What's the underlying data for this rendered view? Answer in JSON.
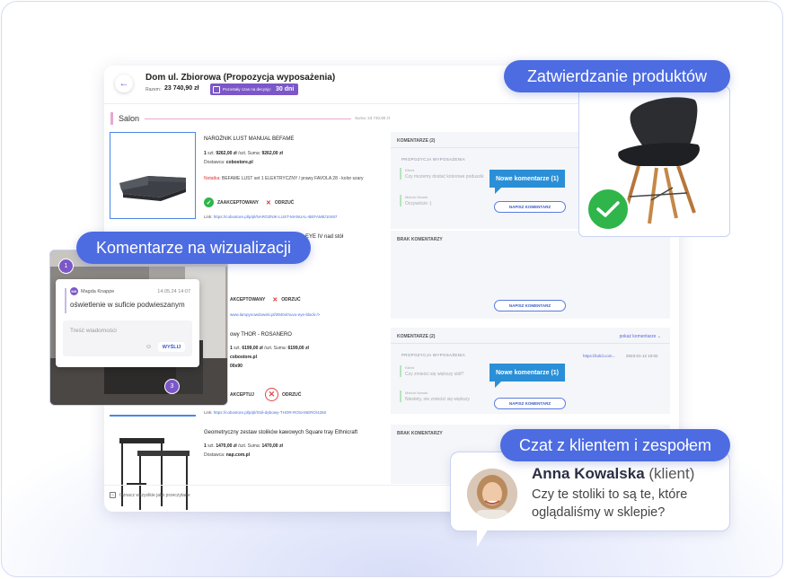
{
  "app": {
    "title": "Dom ul. Zbiorowa (Propozycja wyposażenia)",
    "sum_label": "Razem:",
    "sum_value": "23 740,90 zł",
    "deadline_text": "Pozostały czas na decyzję:",
    "deadline_days": "30 dni",
    "section_name": "Salon",
    "section_sum": "Suma: 23 740,90 zł",
    "mark_all_label": "Oznacz wszystkie jako przeczytane"
  },
  "products": [
    {
      "name": "NAROŻNIK LUST MANUAL BEFAME",
      "qty": "1",
      "unit": "szt.",
      "price": "9262,00 zł",
      "per": "/szt.",
      "sum_label": "Suma:",
      "sum": "9262,00 zł",
      "supplier_label": "Dostawca:",
      "supplier": "cobostore.pl",
      "note_label": "Notatka:",
      "note": "BEFAME LUST set 1 ELEKTRYCZNY / prawy FAVOLA 28 - kolor szary",
      "accepted": "ZAAKCEPTOWANY",
      "rejected": "ODRZUĆ",
      "link_label": "Link:",
      "link": "https://cobostore.pl/p/pl/NAROZNIK-LUST-MANUAL-BEFAME/10497"
    },
    {
      "name_partial": "EYE IV nad stół",
      "accepted": "AKCEPTOWANY",
      "rejected": "ODRZUĆ",
      "link": "www.lampynowdowski.pl/39404/nuvo-eye-black-/>"
    },
    {
      "name_partial": "owy THOR - ROSANERO",
      "qty": "1",
      "unit": "szt.",
      "price": "6199,00 zł",
      "per": "/szt.",
      "sum_label": "Suma:",
      "sum": "6199,00 zł",
      "supplier": "cobostore.pl",
      "size": "00x90",
      "accepted": "AKCEPTUJ",
      "rejected": "ODRZUĆ",
      "link": "https://cobostore.pl/p/pl/Stół-dębowy-THOR-ROSANERO/4260"
    },
    {
      "name": "Geometryczny zestaw stolików kawowych Square tray Ethnicraft",
      "qty": "1",
      "unit": "szt.",
      "price": "1470,00 zł",
      "per": "/szt.",
      "sum_label": "Suma:",
      "sum": "1470,00 zł",
      "supplier_label": "Dostawca:",
      "supplier": "nap.com.pl"
    }
  ],
  "comments": [
    {
      "header": "KOMENTARZE (2)",
      "tag": "PROPOZYCJA WYPOSAŻENIA",
      "quote_label": "Klient",
      "quote": "Czy możemy dostać kolorowe poduszki",
      "reply_label": "Marcin Nowak",
      "reply": "Oczywiście :)",
      "new_badge": "Nowe komentarze (1)",
      "write": "NAPISZ KOMENTARZ"
    },
    {
      "header": "BRAK KOMENTARZY",
      "write": "NAPISZ KOMENTARZ"
    },
    {
      "header": "KOMENTARZE (2)",
      "show": "pokaż komentarze ⌄",
      "tag": "PROPOZYCJA WYPOSAŻENIA",
      "link": "https://kolid.com...",
      "date": "2023-01-12 10:02",
      "quote_label": "Klient",
      "quote": "Czy zmieści się większy stół?",
      "reply_label": "Marcin Nowak",
      "reply": "Niestety, nie zmieści się większy",
      "new_badge": "Nowe komentarze (1)",
      "write": "NAPISZ KOMENTARZ"
    },
    {
      "header": "BRAK KOMENTARZY"
    }
  ],
  "callouts": {
    "approve": "Zatwierdzanie produktów",
    "viz": "Komentarze na wizualizacji",
    "chat": "Czat z klientem i zespołem"
  },
  "viz": {
    "marker1": "1",
    "marker3": "3",
    "avatar": "MK",
    "author": "Magda Knappe",
    "time": "14.05.24 14:07",
    "message": "oświetlenie w suficie podwieszanym",
    "placeholder": "Treść wiadomości",
    "send": "WYŚLIJ"
  },
  "chat": {
    "name": "Anna Kowalska",
    "role": "(klient)",
    "message": "Czy te stoliki to są te, które oglądaliśmy w sklepie?"
  },
  "colors": {
    "accent": "#4d6ce2",
    "purple": "#7b57c8",
    "green": "#2fb54a",
    "blue_badge": "#2a8fd6",
    "red": "#e04848"
  }
}
